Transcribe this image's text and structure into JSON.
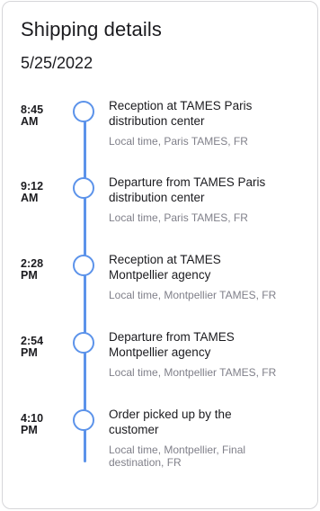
{
  "header": {
    "title": "Shipping details",
    "date": "5/25/2022"
  },
  "timeline": {
    "accent_color": "#5c93ea",
    "events": [
      {
        "time_hm": "8:45",
        "time_period": "AM",
        "title_line1": "Reception at TAMES Paris",
        "title_line2": "distribution center",
        "location": "Local time, Paris TAMES, FR"
      },
      {
        "time_hm": "9:12",
        "time_period": "AM",
        "title_line1": "Departure from TAMES Paris",
        "title_line2": "distribution center",
        "location": "Local time, Paris TAMES, FR"
      },
      {
        "time_hm": "2:28",
        "time_period": "PM",
        "title_line1": "Reception at TAMES",
        "title_line2": "Montpellier agency",
        "location": "Local time, Montpellier TAMES, FR"
      },
      {
        "time_hm": "2:54",
        "time_period": "PM",
        "title_line1": "Departure from TAMES",
        "title_line2": "Montpellier agency",
        "location": "Local time, Montpellier TAMES, FR"
      },
      {
        "time_hm": "4:10",
        "time_period": "PM",
        "title_line1": "Order picked up by the",
        "title_line2": "customer",
        "location_line1": "Local time, Montpellier, Final",
        "location_line2": "destination, FR"
      }
    ]
  }
}
